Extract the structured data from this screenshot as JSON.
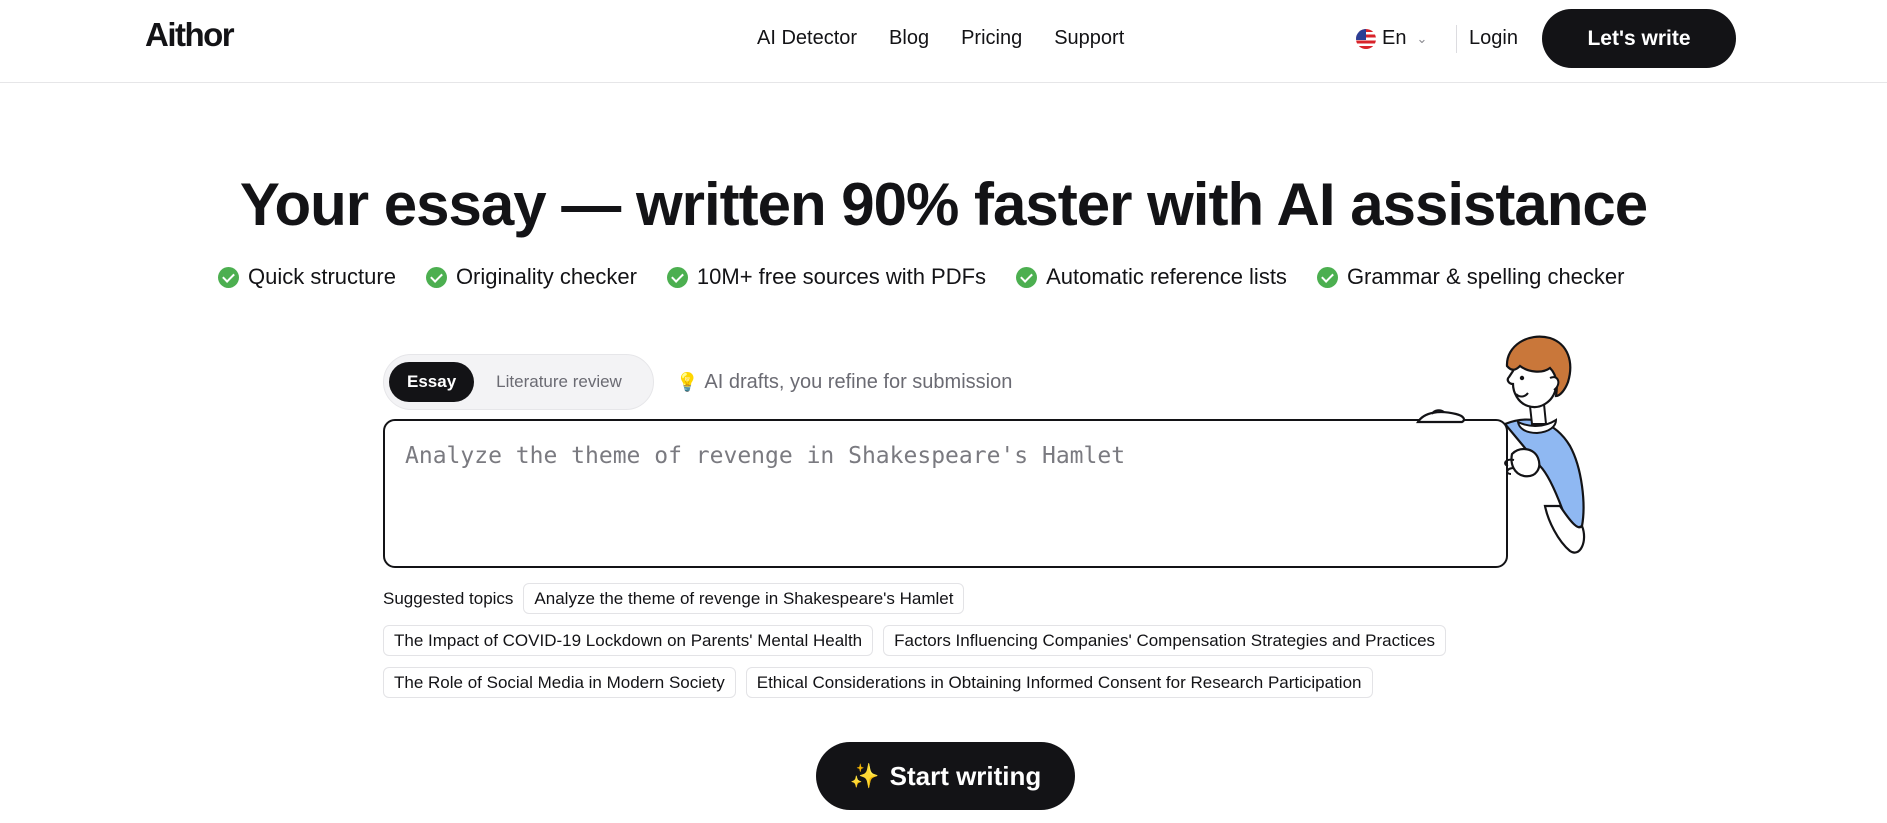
{
  "header": {
    "logo": "Aithor",
    "nav": [
      "AI Detector",
      "Blog",
      "Pricing",
      "Support"
    ],
    "language": "En",
    "login_label": "Login",
    "cta_label": "Let's write"
  },
  "hero": {
    "title": "Your essay — written 90% faster with AI assistance",
    "features": [
      "Quick structure",
      "Originality checker",
      "10M+ free sources with PDFs",
      "Automatic reference lists",
      "Grammar & spelling checker"
    ]
  },
  "editor": {
    "tabs": [
      "Essay",
      "Literature review"
    ],
    "active_tab": "Essay",
    "hint": "AI drafts, you refine for submission",
    "placeholder": "Analyze the theme of revenge in Shakespeare's Hamlet",
    "value": ""
  },
  "suggested": {
    "label": "Suggested topics",
    "topics": [
      "Analyze the theme of revenge in Shakespeare's Hamlet",
      "The Impact of COVID-19 Lockdown on Parents' Mental Health",
      "Factors Influencing Companies' Compensation Strategies and Practices",
      "The Role of Social Media in Modern Society",
      "Ethical Considerations in Obtaining Informed Consent for Research Participation"
    ]
  },
  "cta": {
    "start_label": "Start writing"
  },
  "colors": {
    "accent_dark": "#131316",
    "check_green": "#4caf50",
    "sleeve_blue": "#8fb8f2",
    "hair_brown": "#c9773a"
  },
  "icons": [
    "us-flag-icon",
    "chevron-down-icon",
    "check-circle-icon",
    "lightbulb-icon",
    "sparkles-icon"
  ]
}
